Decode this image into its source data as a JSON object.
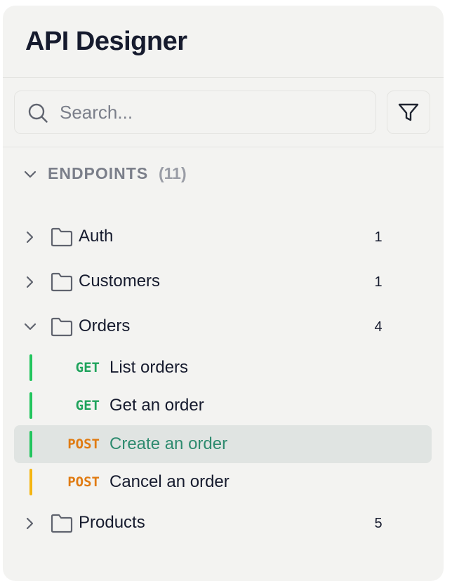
{
  "app": {
    "title": "API Designer"
  },
  "search": {
    "placeholder": "Search...",
    "value": ""
  },
  "section": {
    "label": "ENDPOINTS",
    "count": "(11)",
    "expanded": true
  },
  "folders": [
    {
      "label": "Auth",
      "count": "1",
      "expanded": false
    },
    {
      "label": "Customers",
      "count": "1",
      "expanded": false
    },
    {
      "label": "Orders",
      "count": "4",
      "expanded": true,
      "endpoints": [
        {
          "method": "GET",
          "label": "List orders",
          "method_color": "#1fa35c",
          "bar_color": "#22c55e",
          "selected": false
        },
        {
          "method": "GET",
          "label": "Get an order",
          "method_color": "#1fa35c",
          "bar_color": "#22c55e",
          "selected": false
        },
        {
          "method": "POST",
          "label": "Create an order",
          "method_color": "#e07b12",
          "bar_color": "#22c55e",
          "selected": true
        },
        {
          "method": "POST",
          "label": "Cancel an order",
          "method_color": "#e07b12",
          "bar_color": "#f5b511",
          "selected": false
        }
      ]
    },
    {
      "label": "Products",
      "count": "5",
      "expanded": false
    }
  ],
  "colors": {
    "panel_bg": "#f3f3f1",
    "title": "#161b2e",
    "muted": "#7b7f8a",
    "selected_bg": "#e0e4e2",
    "selected_text": "#2e8b6f",
    "get": "#1fa35c",
    "post": "#e07b12"
  },
  "icons": {
    "search": "search-icon",
    "filter": "filter-icon",
    "folder": "folder-icon",
    "expand": "chevron-right-icon",
    "collapse": "chevron-down-icon"
  }
}
